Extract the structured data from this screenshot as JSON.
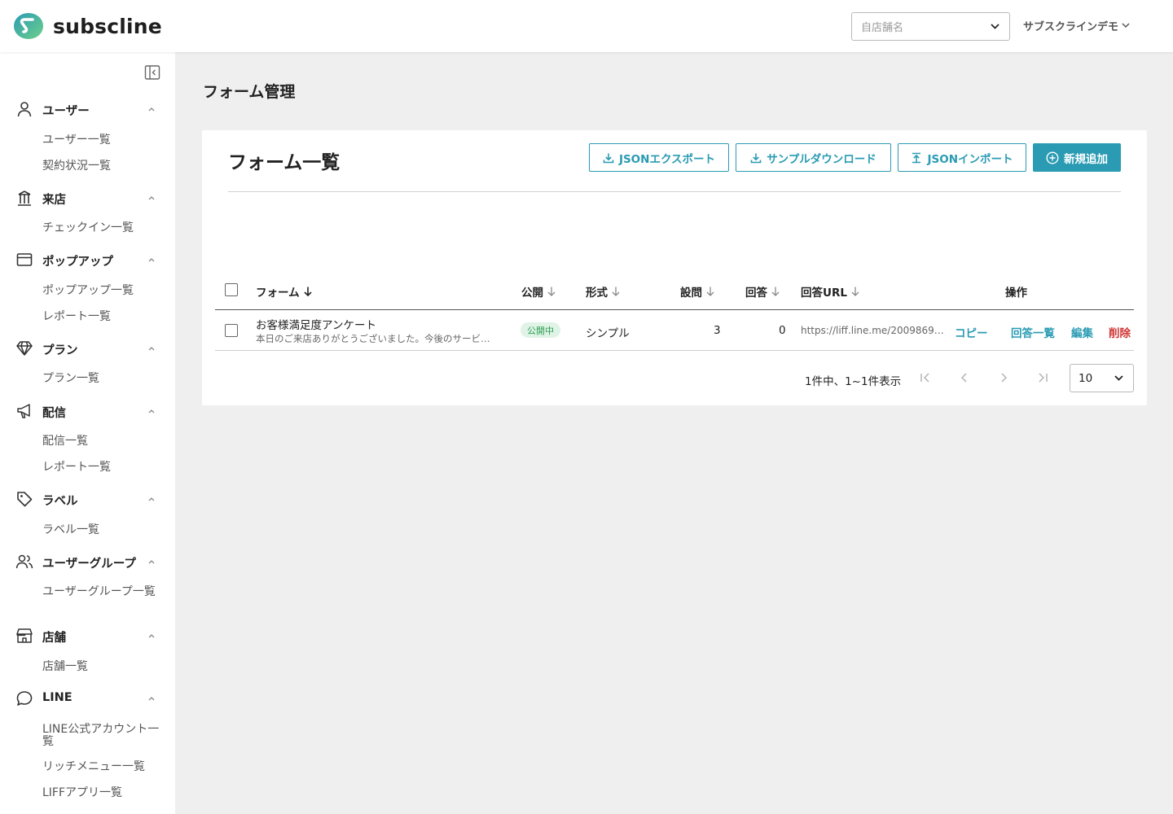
{
  "brand": {
    "name": "subscline"
  },
  "header": {
    "store_select_placeholder": "自店舗名",
    "user_name": "サブスクラインデモ"
  },
  "sidebar": {
    "groups": [
      {
        "label": "ユーザー",
        "icon": "person-icon",
        "items": [
          "ユーザー一覧",
          "契約状況一覧"
        ]
      },
      {
        "label": "来店",
        "icon": "building-icon",
        "items": [
          "チェックイン一覧"
        ]
      },
      {
        "label": "ポップアップ",
        "icon": "window-icon",
        "items": [
          "ポップアップ一覧",
          "レポート一覧"
        ]
      },
      {
        "label": "プラン",
        "icon": "diamond-icon",
        "items": [
          "プラン一覧"
        ]
      },
      {
        "label": "配信",
        "icon": "megaphone-icon",
        "items": [
          "配信一覧",
          "レポート一覧"
        ]
      },
      {
        "label": "ラベル",
        "icon": "tag-icon",
        "items": [
          "ラベル一覧"
        ]
      },
      {
        "label": "ユーザーグループ",
        "icon": "people-icon",
        "items": [
          "ユーザーグループ一覧"
        ]
      },
      {
        "label": "店舗",
        "icon": "store-icon",
        "items": [
          "店舗一覧"
        ]
      },
      {
        "label": "LINE",
        "icon": "chat-bubble-icon",
        "items": [
          "LINE公式アカウント一覧",
          "リッチメニュー一覧",
          "LIFFアプリ一覧"
        ]
      }
    ]
  },
  "page": {
    "title": "フォーム管理"
  },
  "card": {
    "title": "フォーム一覧",
    "buttons": {
      "json_export": "JSONエクスポート",
      "sample_download": "サンプルダウンロード",
      "json_import": "JSONインポート",
      "add_new": "新規追加"
    }
  },
  "table": {
    "headers": {
      "form": "フォーム",
      "published": "公開",
      "format": "形式",
      "questions": "設問",
      "answers": "回答",
      "answer_url": "回答URL",
      "actions": "操作"
    },
    "rows": [
      {
        "name": "お客様満足度アンケート",
        "description": "本日のご来店ありがとうございました。今後のサービ…",
        "status": "公開中",
        "format": "シンプル",
        "questions": "3",
        "answers": "0",
        "url": "https://liff.line.me/2009869…",
        "copy": "コピー",
        "answers_link": "回答一覧",
        "edit": "編集",
        "delete": "削除"
      }
    ]
  },
  "pagination": {
    "info": "1件中、1~1件表示",
    "per_page": "10"
  },
  "colors": {
    "accent": "#2a9bb3",
    "danger": "#d03434",
    "badge_bg": "#dff4e6",
    "badge_text": "#2e9b52",
    "logo_green": "#4fc28a",
    "logo_blue": "#2a9bb3"
  }
}
